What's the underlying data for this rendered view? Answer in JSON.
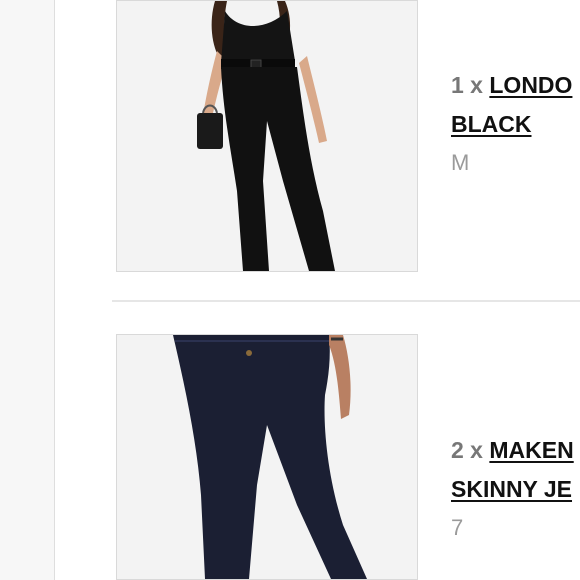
{
  "cart": {
    "items": [
      {
        "quantity": "1 x",
        "name_line1": "LONDO",
        "name_line2": "BLACK",
        "size": "M",
        "image_icon": "product-photo-black-jumpsuit"
      },
      {
        "quantity": "2 x",
        "name_line1": "MAKEN",
        "name_line2": "SKINNY JE",
        "size": "7",
        "image_icon": "product-photo-dark-skinny-jeans"
      }
    ]
  },
  "colors": {
    "page_background": "#f7f7f7",
    "panel_background": "#ffffff",
    "product_text": "#111111",
    "quantity_text": "#777777",
    "size_text": "#9a9a9a"
  }
}
